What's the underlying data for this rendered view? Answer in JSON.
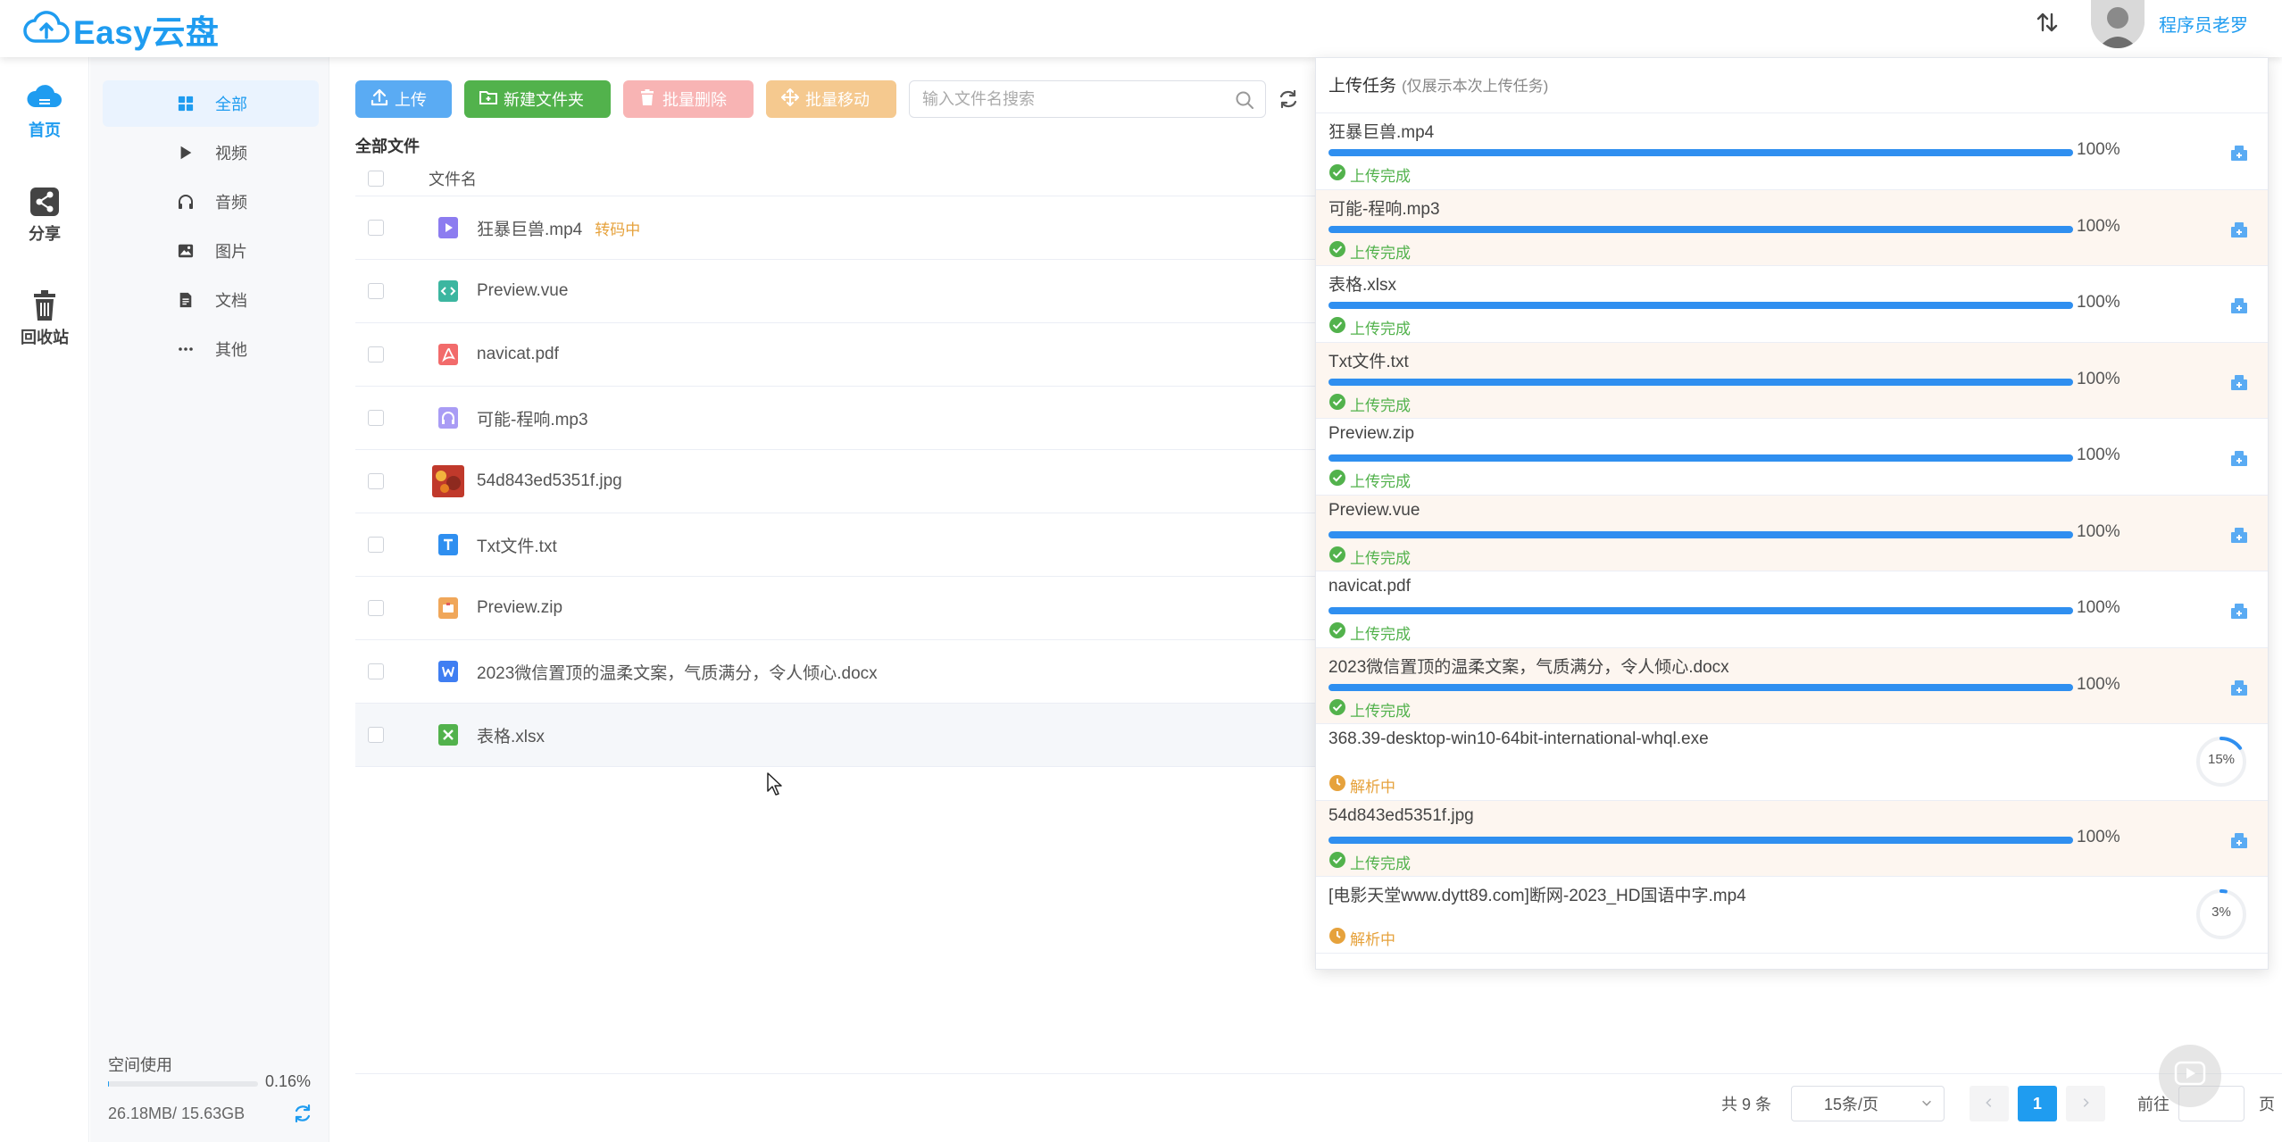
{
  "app": {
    "logo_text": "Easy云盘",
    "username": "程序员老罗",
    "brand_color": "#1f9cf0"
  },
  "leftnav": [
    {
      "label": "首页",
      "icon": "cloud-icon",
      "active": true
    },
    {
      "label": "分享",
      "icon": "share-icon",
      "active": false
    },
    {
      "label": "回收站",
      "icon": "trash-icon",
      "active": false
    }
  ],
  "categories": [
    {
      "label": "全部",
      "icon": "grid-icon",
      "active": true
    },
    {
      "label": "视频",
      "icon": "play-icon",
      "active": false
    },
    {
      "label": "音频",
      "icon": "headphones-icon",
      "active": false
    },
    {
      "label": "图片",
      "icon": "image-icon",
      "active": false
    },
    {
      "label": "文档",
      "icon": "document-icon",
      "active": false
    },
    {
      "label": "其他",
      "icon": "more-icon",
      "active": false
    }
  ],
  "space": {
    "title": "空间使用",
    "percent_text": "0.16%",
    "used_fraction": 0.0016,
    "size_text": "26.18MB/ 15.63GB"
  },
  "toolbar": {
    "upload_label": "上传",
    "newfolder_label": "新建文件夹",
    "batch_delete_label": "批量删除",
    "batch_move_label": "批量移动",
    "search_placeholder": "输入文件名搜索"
  },
  "breadcrumb": "全部文件",
  "table": {
    "header": "文件名",
    "rows": [
      {
        "name": "狂暴巨兽.mp4",
        "type": "video",
        "tag": "转码中"
      },
      {
        "name": "Preview.vue",
        "type": "code",
        "tag": ""
      },
      {
        "name": "navicat.pdf",
        "type": "pdf",
        "tag": ""
      },
      {
        "name": "可能-程响.mp3",
        "type": "audio",
        "tag": ""
      },
      {
        "name": "54d843ed5351f.jpg",
        "type": "image",
        "tag": ""
      },
      {
        "name": "Txt文件.txt",
        "type": "txt",
        "tag": ""
      },
      {
        "name": "Preview.zip",
        "type": "zip",
        "tag": ""
      },
      {
        "name": "2023微信置顶的温柔文案，气质满分，令人倾心.docx",
        "type": "word",
        "tag": ""
      },
      {
        "name": "表格.xlsx",
        "type": "excel",
        "tag": ""
      }
    ]
  },
  "pager": {
    "total": "共 9 条",
    "page_size": "15条/页",
    "current": "1",
    "goto": "前往",
    "page_suffix": "页"
  },
  "upload_panel": {
    "title": "上传任务",
    "subtitle": "(仅展示本次上传任务)",
    "tasks": [
      {
        "name": "狂暴巨兽.mp4",
        "progress": 100,
        "progress_text": "100%",
        "status": "上传完成",
        "state": "done"
      },
      {
        "name": "可能-程响.mp3",
        "progress": 100,
        "progress_text": "100%",
        "status": "上传完成",
        "state": "done"
      },
      {
        "name": "表格.xlsx",
        "progress": 100,
        "progress_text": "100%",
        "status": "上传完成",
        "state": "done"
      },
      {
        "name": "Txt文件.txt",
        "progress": 100,
        "progress_text": "100%",
        "status": "上传完成",
        "state": "done"
      },
      {
        "name": "Preview.zip",
        "progress": 100,
        "progress_text": "100%",
        "status": "上传完成",
        "state": "done"
      },
      {
        "name": "Preview.vue",
        "progress": 100,
        "progress_text": "100%",
        "status": "上传完成",
        "state": "done"
      },
      {
        "name": "navicat.pdf",
        "progress": 100,
        "progress_text": "100%",
        "status": "上传完成",
        "state": "done"
      },
      {
        "name": "2023微信置顶的温柔文案，气质满分，令人倾心.docx",
        "progress": 100,
        "progress_text": "100%",
        "status": "上传完成",
        "state": "done"
      },
      {
        "name": "368.39-desktop-win10-64bit-international-whql.exe",
        "progress": 15,
        "progress_text": "15%",
        "status": "解析中",
        "state": "parsing"
      },
      {
        "name": "54d843ed5351f.jpg",
        "progress": 100,
        "progress_text": "100%",
        "status": "上传完成",
        "state": "done"
      },
      {
        "name": "[电影天堂www.dytt89.com]断网-2023_HD国语中字.mp4",
        "progress": 3,
        "progress_text": "3%",
        "status": "解析中",
        "state": "parsing"
      }
    ]
  }
}
